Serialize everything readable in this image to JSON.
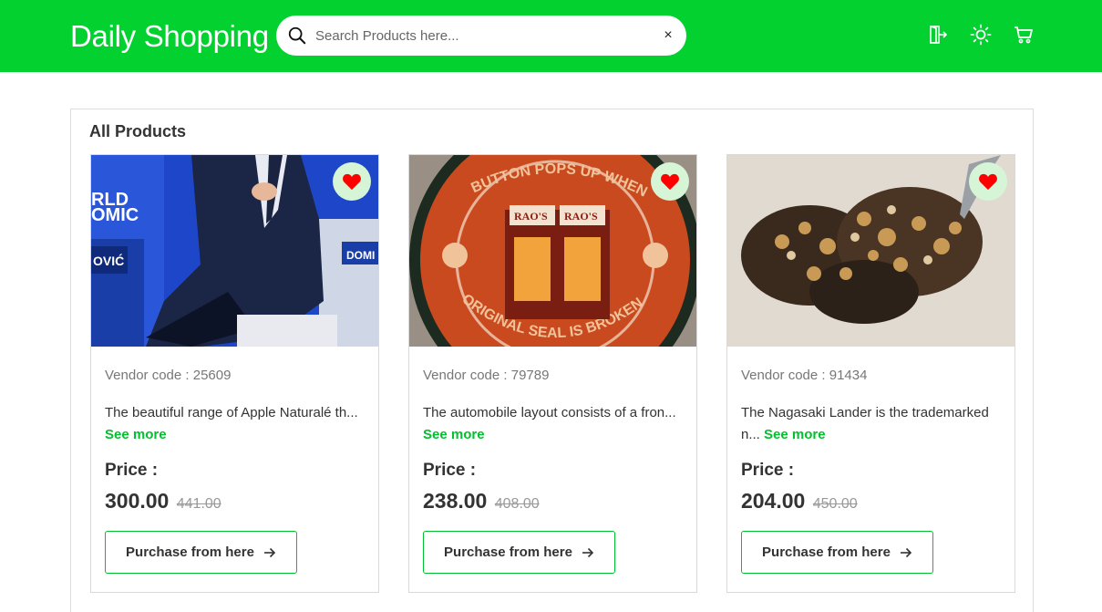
{
  "header": {
    "brand": "Daily Shopping",
    "search_placeholder": "Search Products here...",
    "search_value": "",
    "clear_label": "×",
    "icons": [
      "login-icon",
      "sun-icon",
      "cart-icon"
    ],
    "accent": "#02d130"
  },
  "main": {
    "section_title": "All Products",
    "price_label": "Price :",
    "purchase_label": "Purchase from here",
    "see_more": "See more",
    "products": [
      {
        "vendor": "Vendor code : 25609",
        "desc": "The beautiful range of Apple Naturalé th...",
        "price": "300.00",
        "old_price": "441.00",
        "image": "man-in-suit-at-forum"
      },
      {
        "vendor": "Vendor code : 79789",
        "desc": "The automobile layout consists of a fron...",
        "price": "238.00",
        "old_price": "408.00",
        "image": "raos-jar-lid"
      },
      {
        "vendor": "Vendor code : 91434",
        "desc": "The Nagasaki Lander is the trademarked n...",
        "price": "204.00",
        "old_price": "450.00",
        "image": "stuffed-mushrooms-dish"
      }
    ]
  },
  "colors": {
    "header": "#02d130",
    "see_more": "#02c02e",
    "heart": "#ff0000",
    "fav_bg": "#d6f5d6"
  }
}
